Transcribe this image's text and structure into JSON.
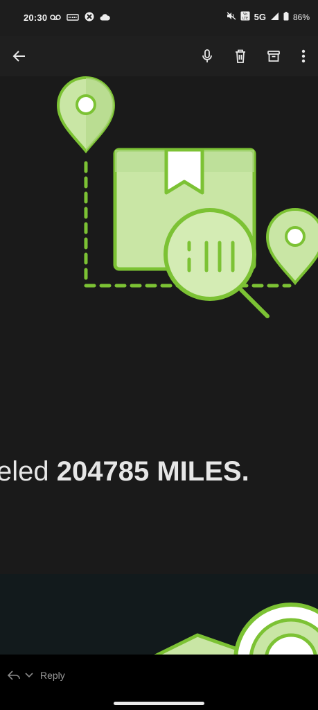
{
  "status_bar": {
    "time": "20:30",
    "network": "5G",
    "battery": "86%",
    "icons_left": [
      "voicemail-icon",
      "keyboard-icon",
      "blocked-app-icon",
      "cloud-icon"
    ],
    "icons_right": [
      "mute-icon",
      "volte-icon",
      "signal-icon",
      "battery-icon"
    ]
  },
  "app_bar": {
    "icons": [
      "back-arrow-icon",
      "microphone-icon",
      "trash-icon",
      "archive-icon",
      "more-vert-icon"
    ]
  },
  "email_body": {
    "miles_prefix": "eled ",
    "miles_value": "204785 MILES.",
    "illustration": "package-tracking-illustration"
  },
  "reply_bar": {
    "label": "Reply"
  },
  "colors": {
    "accent_green": "#7cc234",
    "light_green": "#c9e6a5",
    "background": "#1a1a1a"
  }
}
